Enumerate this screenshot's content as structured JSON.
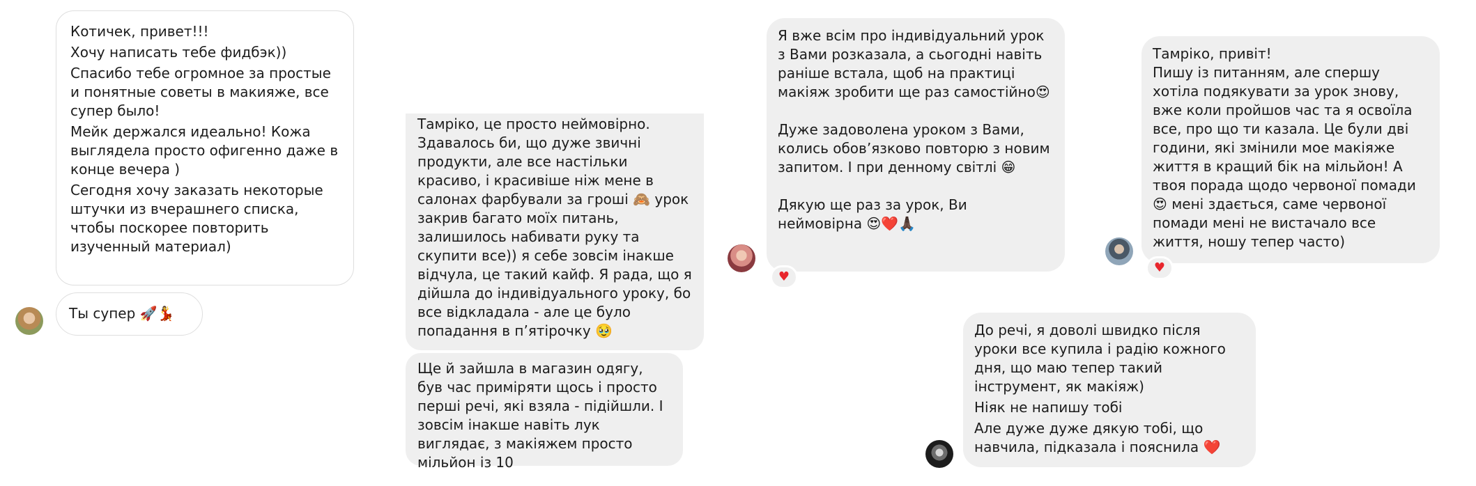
{
  "chat1": {
    "message1": {
      "lines": [
        "Котичек, привет!!!",
        "Хочу написать тебе фидбэк))",
        "Спасибо тебе огромное за простые и понятные советы в макияже, все супер было!",
        "Мейк держался идеально! Кожа выглядела просто офигенно даже в конце вечера )",
        "Сегодня хочу заказать некоторые штучки из вчерашнего списка, чтобы поскорее повторить изученный материал)"
      ]
    },
    "message2": {
      "text": "Ты супер 🚀💃"
    }
  },
  "chat2": {
    "message1": {
      "text": "Тамріко, це просто неймовірно. Здавалось би, що дуже звичні продукти, але все настільки красиво, і красивіше ніж мене в салонах фарбували за гроші 🙈 урок закрив багато моїх питань, залишилось набивати руку та скупити все)) я себе зовсім інакше відчула, це такий кайф. Я рада, що я дійшла до індивідуального уроку, бо все відкладала - але це було попадання в п’ятірочку 🥹"
    },
    "message2": {
      "text": "Ще й зайшла в магазин одягу, був час приміряти щось і просто перші речі, які взяла - підійшли. І зовсім інакше навіть лук виглядає, з макіяжем просто мільйон із 10"
    }
  },
  "chat3": {
    "message": {
      "paragraph1": "Я вже всім про індивідуальний урок з Вами розказала, а сьогодні навіть раніше встала, щоб на практиці макіяж зробити ще раз самостійно😍",
      "paragraph2": "Дуже задоволена уроком з Вами, колись обов’язково повторю з новим запитом. І при денному світлі 😁",
      "paragraph3": "Дякую ще раз за урок, Ви неймовірна 😍❤️🙏🏿"
    },
    "reaction": "♥"
  },
  "chat4": {
    "message": {
      "greeting": "Тамріко, привіт!",
      "body": "Пишу із питанням, але спершу хотіла подякувати за урок знову, вже коли пройшов час та я освоїла все, про що ти казала. Це були дві години, які змінили мое макіяже життя в кращий бік на мільйон! А твоя порада щодо червоної помади 😍 мені здається, саме червоної помади мені не вистачало все життя, ношу тепер часто)"
    },
    "reaction": "♥"
  },
  "chat5": {
    "message": {
      "paragraph1": "До речі, я доволі швидко після уроки все купила і радію кожного дня, що маю тепер такий інструмент, як макіяж)",
      "paragraph2": "Ніяк не напишу тобі",
      "paragraph3": "Але дуже дуже дякую тобі, що навчила, підказала і пояснила ❤️"
    }
  },
  "colors": {
    "bubble_fill": "#efefef",
    "bubble_outline": "#dedede",
    "text": "#1c1c1c",
    "reaction_heart": "#e8262d"
  },
  "icons": {
    "avatar1": "avatar-icon",
    "avatar3": "avatar-icon",
    "avatar4": "avatar-icon",
    "avatar5": "avatar-icon",
    "reaction": "heart-icon"
  }
}
